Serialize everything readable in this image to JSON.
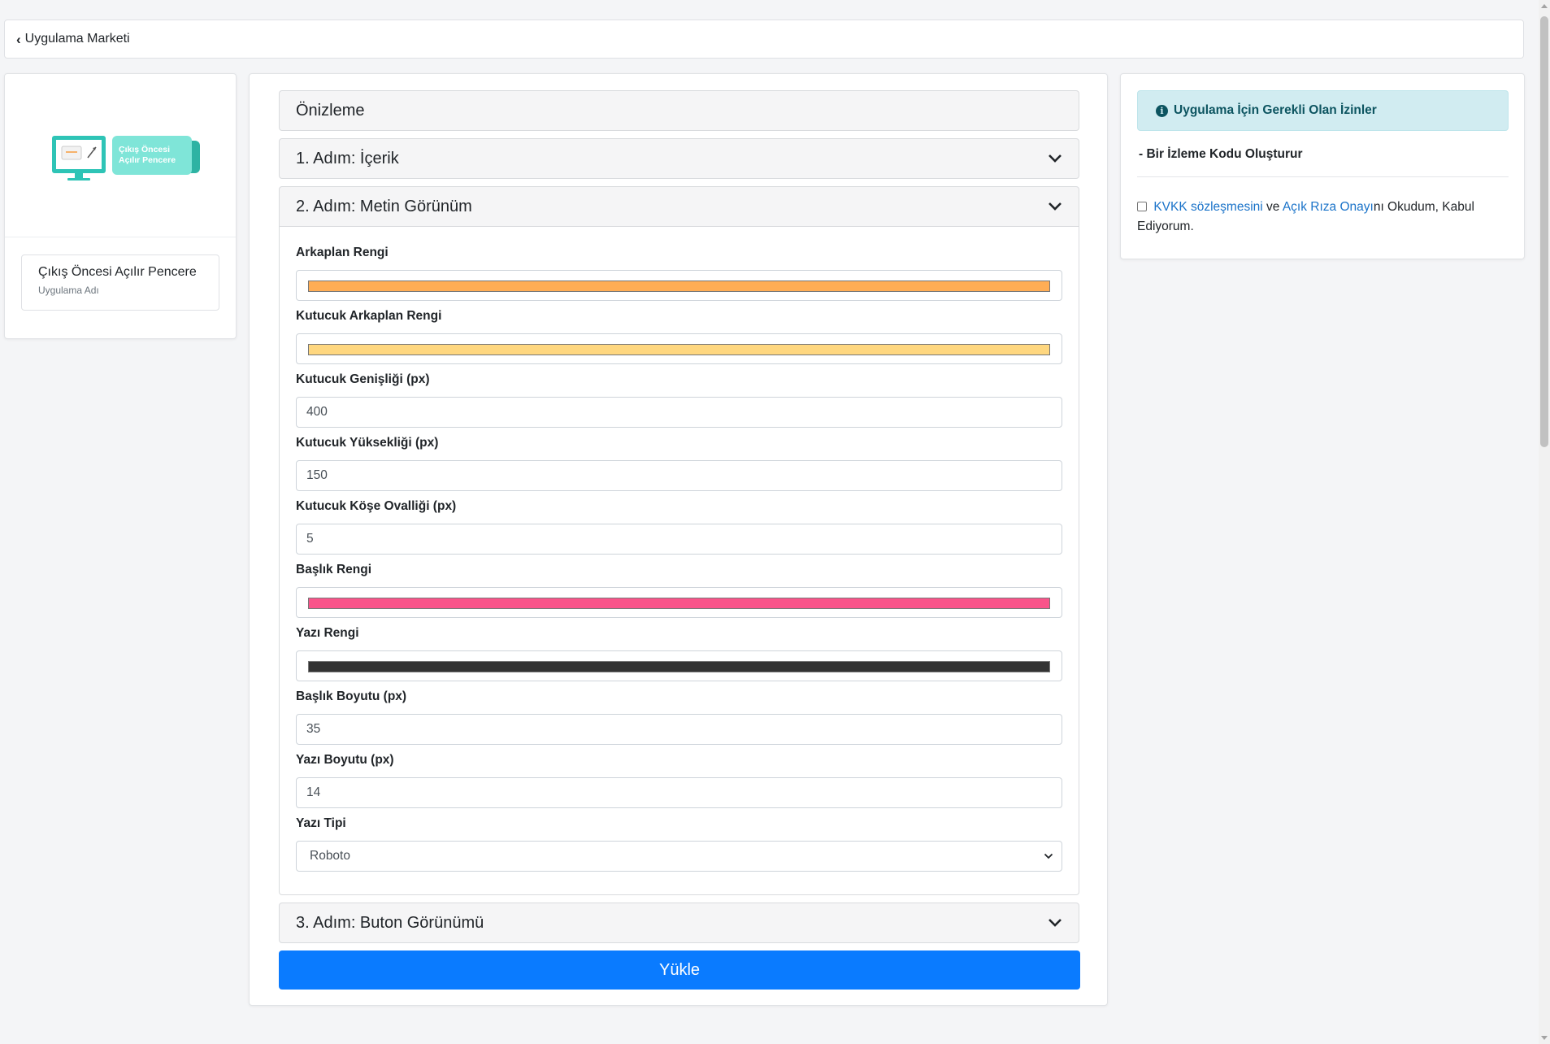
{
  "topbar": {
    "back_label": "Uygulama Marketi"
  },
  "app": {
    "image_title_line1": "Çıkış Öncesi",
    "image_title_line2": "Açılır Pencere",
    "name": "Çıkış Öncesi Açılır Pencere",
    "name_caption": "Uygulama Adı"
  },
  "accordion": {
    "preview": "Önizleme",
    "step1": "1. Adım: İçerik",
    "step2": "2. Adım: Metin Görünüm",
    "step3": "3. Adım: Buton Görünümü"
  },
  "form": {
    "bg_color": {
      "label": "Arkaplan Rengi",
      "value": "#ffad55"
    },
    "box_bg_color": {
      "label": "Kutucuk Arkaplan Rengi",
      "value": "#ffd77f"
    },
    "box_width": {
      "label": "Kutucuk Genişliği (px)",
      "value": "400"
    },
    "box_height": {
      "label": "Kutucuk Yüksekliği (px)",
      "value": "150"
    },
    "box_radius": {
      "label": "Kutucuk Köşe Ovalliği (px)",
      "value": "5"
    },
    "title_color": {
      "label": "Başlık Rengi",
      "value": "#f9548a"
    },
    "text_color": {
      "label": "Yazı Rengi",
      "value": "#333333"
    },
    "title_size": {
      "label": "Başlık Boyutu (px)",
      "value": "35"
    },
    "text_size": {
      "label": "Yazı Boyutu (px)",
      "value": "14"
    },
    "font": {
      "label": "Yazı Tipi",
      "value": "Roboto"
    }
  },
  "submit_label": "Yükle",
  "permissions": {
    "title": "Uygulama İçin Gerekli Olan İzinler",
    "item": "- Bir İzleme Kodu Oluşturur",
    "consent": {
      "link1": "KVKK sözleşmesini",
      "mid": " ve ",
      "link2": "Açık Rıza Onayı",
      "rest": "nı Okudum, Kabul Ediyorum."
    }
  },
  "colors": {
    "primary": "#0a7bff",
    "info_bg": "#d1ecf1",
    "info_text": "#0c5460"
  }
}
